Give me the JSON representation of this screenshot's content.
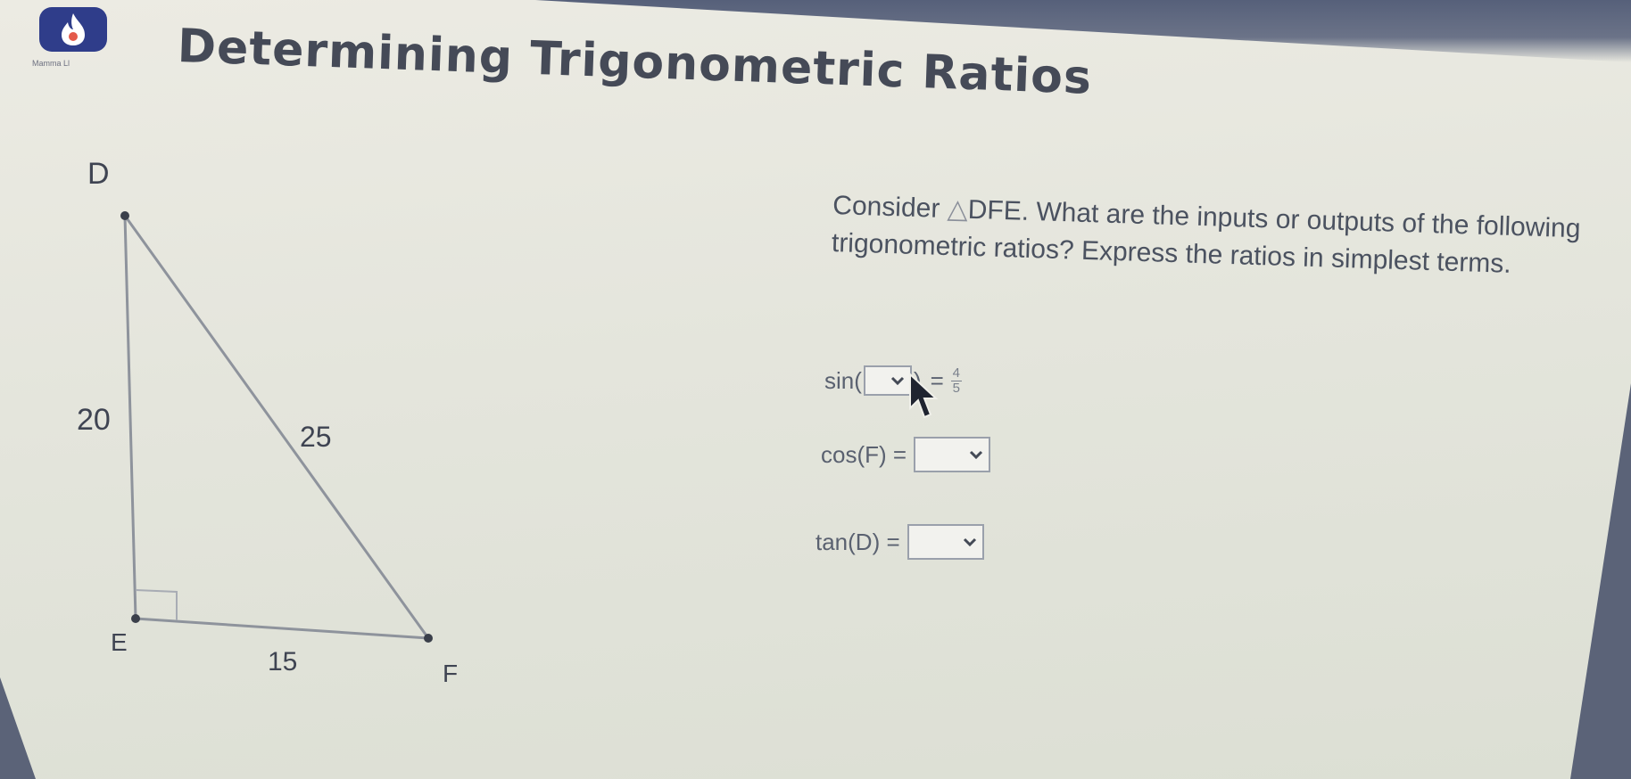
{
  "app": {
    "title": "Determining Trigonometric Ratios",
    "logo_caption": "Mamma Ll",
    "logo_icon": "flame-icon",
    "brand_color": "#2f3d8a"
  },
  "question": {
    "prompt_start": "Consider ",
    "triangle_symbol": "△",
    "triangle_name": "DFE",
    "prompt_end": ". What are the inputs or outputs of the following trigonometric ratios? Express the ratios in simplest terms."
  },
  "figure": {
    "vertices": [
      "D",
      "E",
      "F"
    ],
    "side_DE": "20",
    "side_DF": "25",
    "side_EF": "15"
  },
  "equations": {
    "sin": {
      "func": "sin(",
      "close": ")",
      "equals": "=",
      "num": "4",
      "den": "5"
    },
    "cos": {
      "text": "cos(F) ="
    },
    "tan": {
      "text": "tan(D) ="
    }
  },
  "icons": {
    "dropdown": "chevron-down-icon",
    "cursor": "mouse-pointer-icon"
  }
}
